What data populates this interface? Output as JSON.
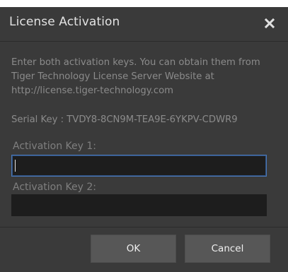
{
  "dialog": {
    "title": "License Activation",
    "close_icon": "close-icon",
    "instructions": "Enter both activation keys. You can obtain them from Tiger Technology License Server Website at http://license.tiger-technology.com",
    "serial_key": "Serial Key : TVDY8-8CN9M-TEA9E-6YKPV-CDWR9",
    "fields": [
      {
        "label": "Activation Key 1:",
        "value": "",
        "focused": true
      },
      {
        "label": "Activation Key 2:",
        "value": "",
        "focused": false
      }
    ],
    "buttons": {
      "ok_label": "OK",
      "cancel_label": "Cancel"
    }
  },
  "colors": {
    "dialog_bg": "#3a3a3a",
    "input_bg": "#1d1d1d",
    "focus_border": "#4a78b7",
    "button_bg": "#575757",
    "title_text": "#e2e2e2",
    "body_text": "#8b8b8b"
  }
}
